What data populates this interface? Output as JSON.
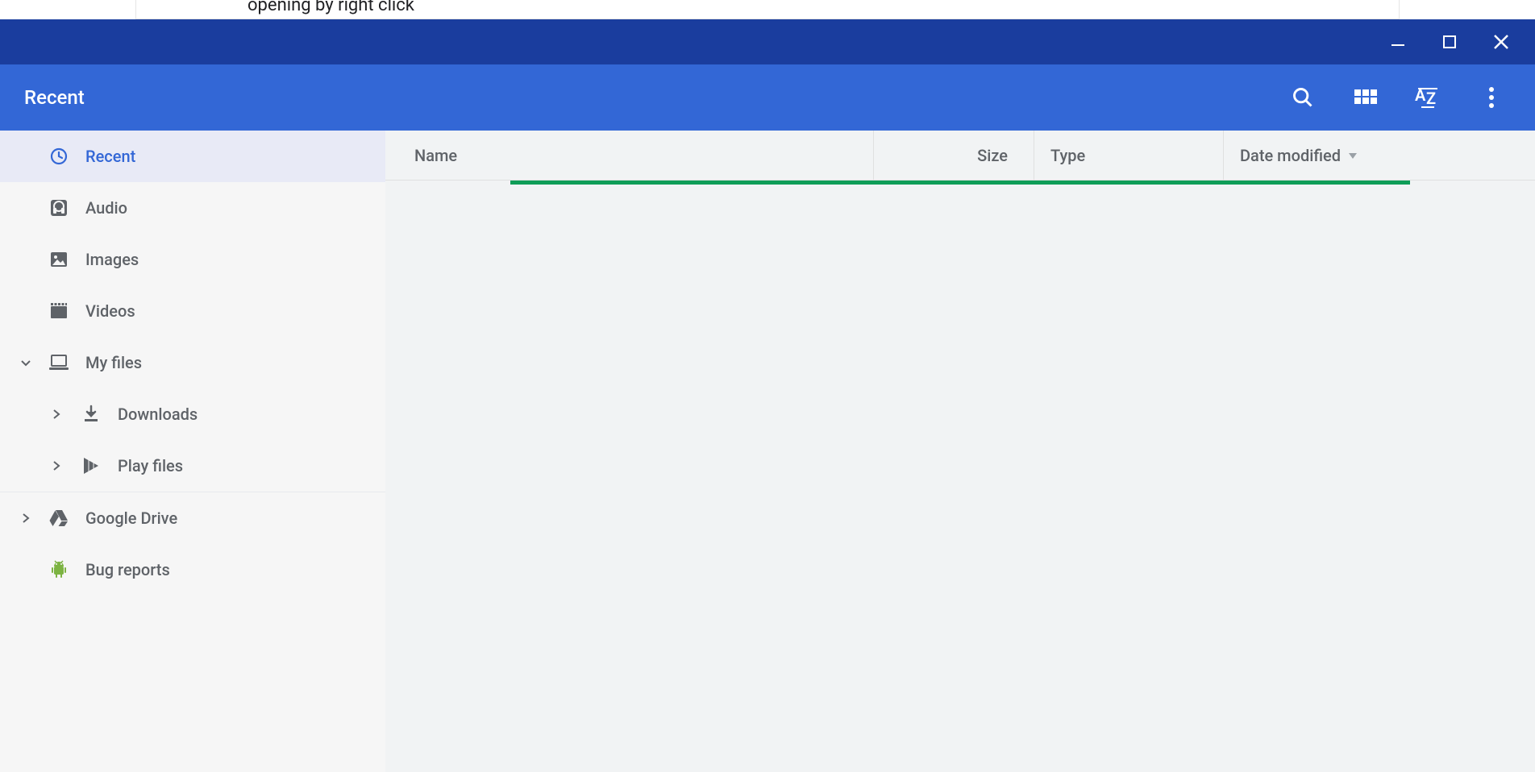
{
  "top_text": "opening by right click",
  "header": {
    "title": "Recent"
  },
  "sidebar": {
    "items": [
      {
        "label": "Recent",
        "name": "sidebar-item-recent"
      },
      {
        "label": "Audio",
        "name": "sidebar-item-audio"
      },
      {
        "label": "Images",
        "name": "sidebar-item-images"
      },
      {
        "label": "Videos",
        "name": "sidebar-item-videos"
      },
      {
        "label": "My files",
        "name": "sidebar-item-myfiles"
      },
      {
        "label": "Downloads",
        "name": "sidebar-item-downloads"
      },
      {
        "label": "Play files",
        "name": "sidebar-item-playfiles"
      },
      {
        "label": "Google Drive",
        "name": "sidebar-item-googledrive"
      },
      {
        "label": "Bug reports",
        "name": "sidebar-item-bugreports"
      }
    ]
  },
  "table": {
    "columns": {
      "name": "Name",
      "size": "Size",
      "type": "Type",
      "date": "Date modified"
    }
  }
}
